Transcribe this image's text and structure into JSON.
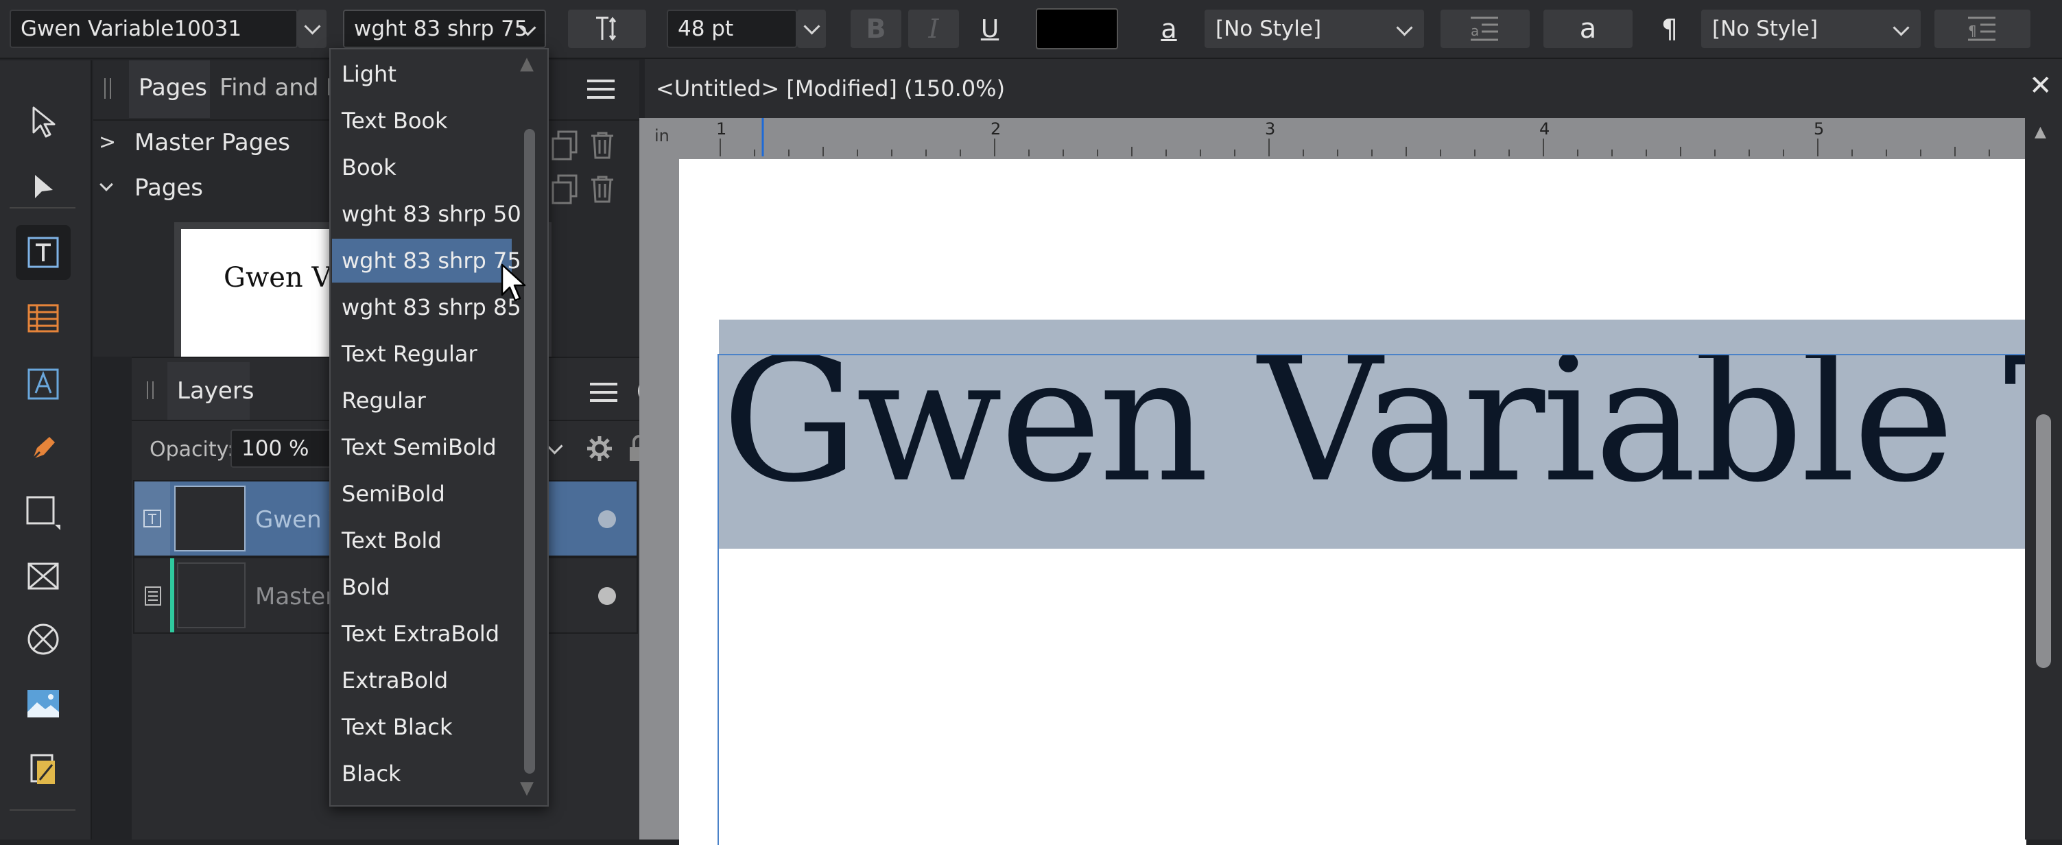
{
  "toolbar": {
    "font_family": "Gwen Variable10031",
    "font_style": "wght 83 shrp 75",
    "font_size": "48 pt",
    "bold_label": "B",
    "italic_label": "I",
    "underline_label": "U",
    "text_color": "#000000",
    "char_style_glyph": "a",
    "char_style": "[No Style]",
    "lowercase_glyph": "a",
    "pilcrow_glyph": "¶",
    "para_style": "[No Style]"
  },
  "pages_panel": {
    "tabs": [
      "Pages",
      "Find and Re"
    ],
    "master_pages_label": "Master Pages",
    "pages_label": "Pages",
    "thumb_text": "Gwen Va"
  },
  "layers_panel": {
    "title": "Layers",
    "opacity_label": "Opacity:",
    "opacity_value": "100 %",
    "layers": [
      {
        "name": "Gwen V",
        "selected": true
      },
      {
        "name": "Master",
        "selected": false
      }
    ]
  },
  "style_menu": {
    "items": [
      "Light",
      "Text Book",
      "Book",
      "wght 83 shrp 50",
      "wght 83 shrp 75",
      "wght 83 shrp 85",
      "Text Regular",
      "Regular",
      "Text SemiBold",
      "SemiBold",
      "Text Bold",
      "Bold",
      "Text ExtraBold",
      "ExtraBold",
      "Text Black",
      "Black"
    ],
    "selected_index": 4
  },
  "document": {
    "title": "<Untitled> [Modified] (150.0%)",
    "ruler_unit": "in",
    "ruler_ticks": [
      "1",
      "2",
      "3",
      "4",
      "5"
    ],
    "text": "Gwen Variable T"
  },
  "colors": {
    "accent": "#4b6d98",
    "selection_highlight": "#a9b5c4",
    "text_dark": "#0c1727",
    "layer_tag": "#2fc99e"
  }
}
